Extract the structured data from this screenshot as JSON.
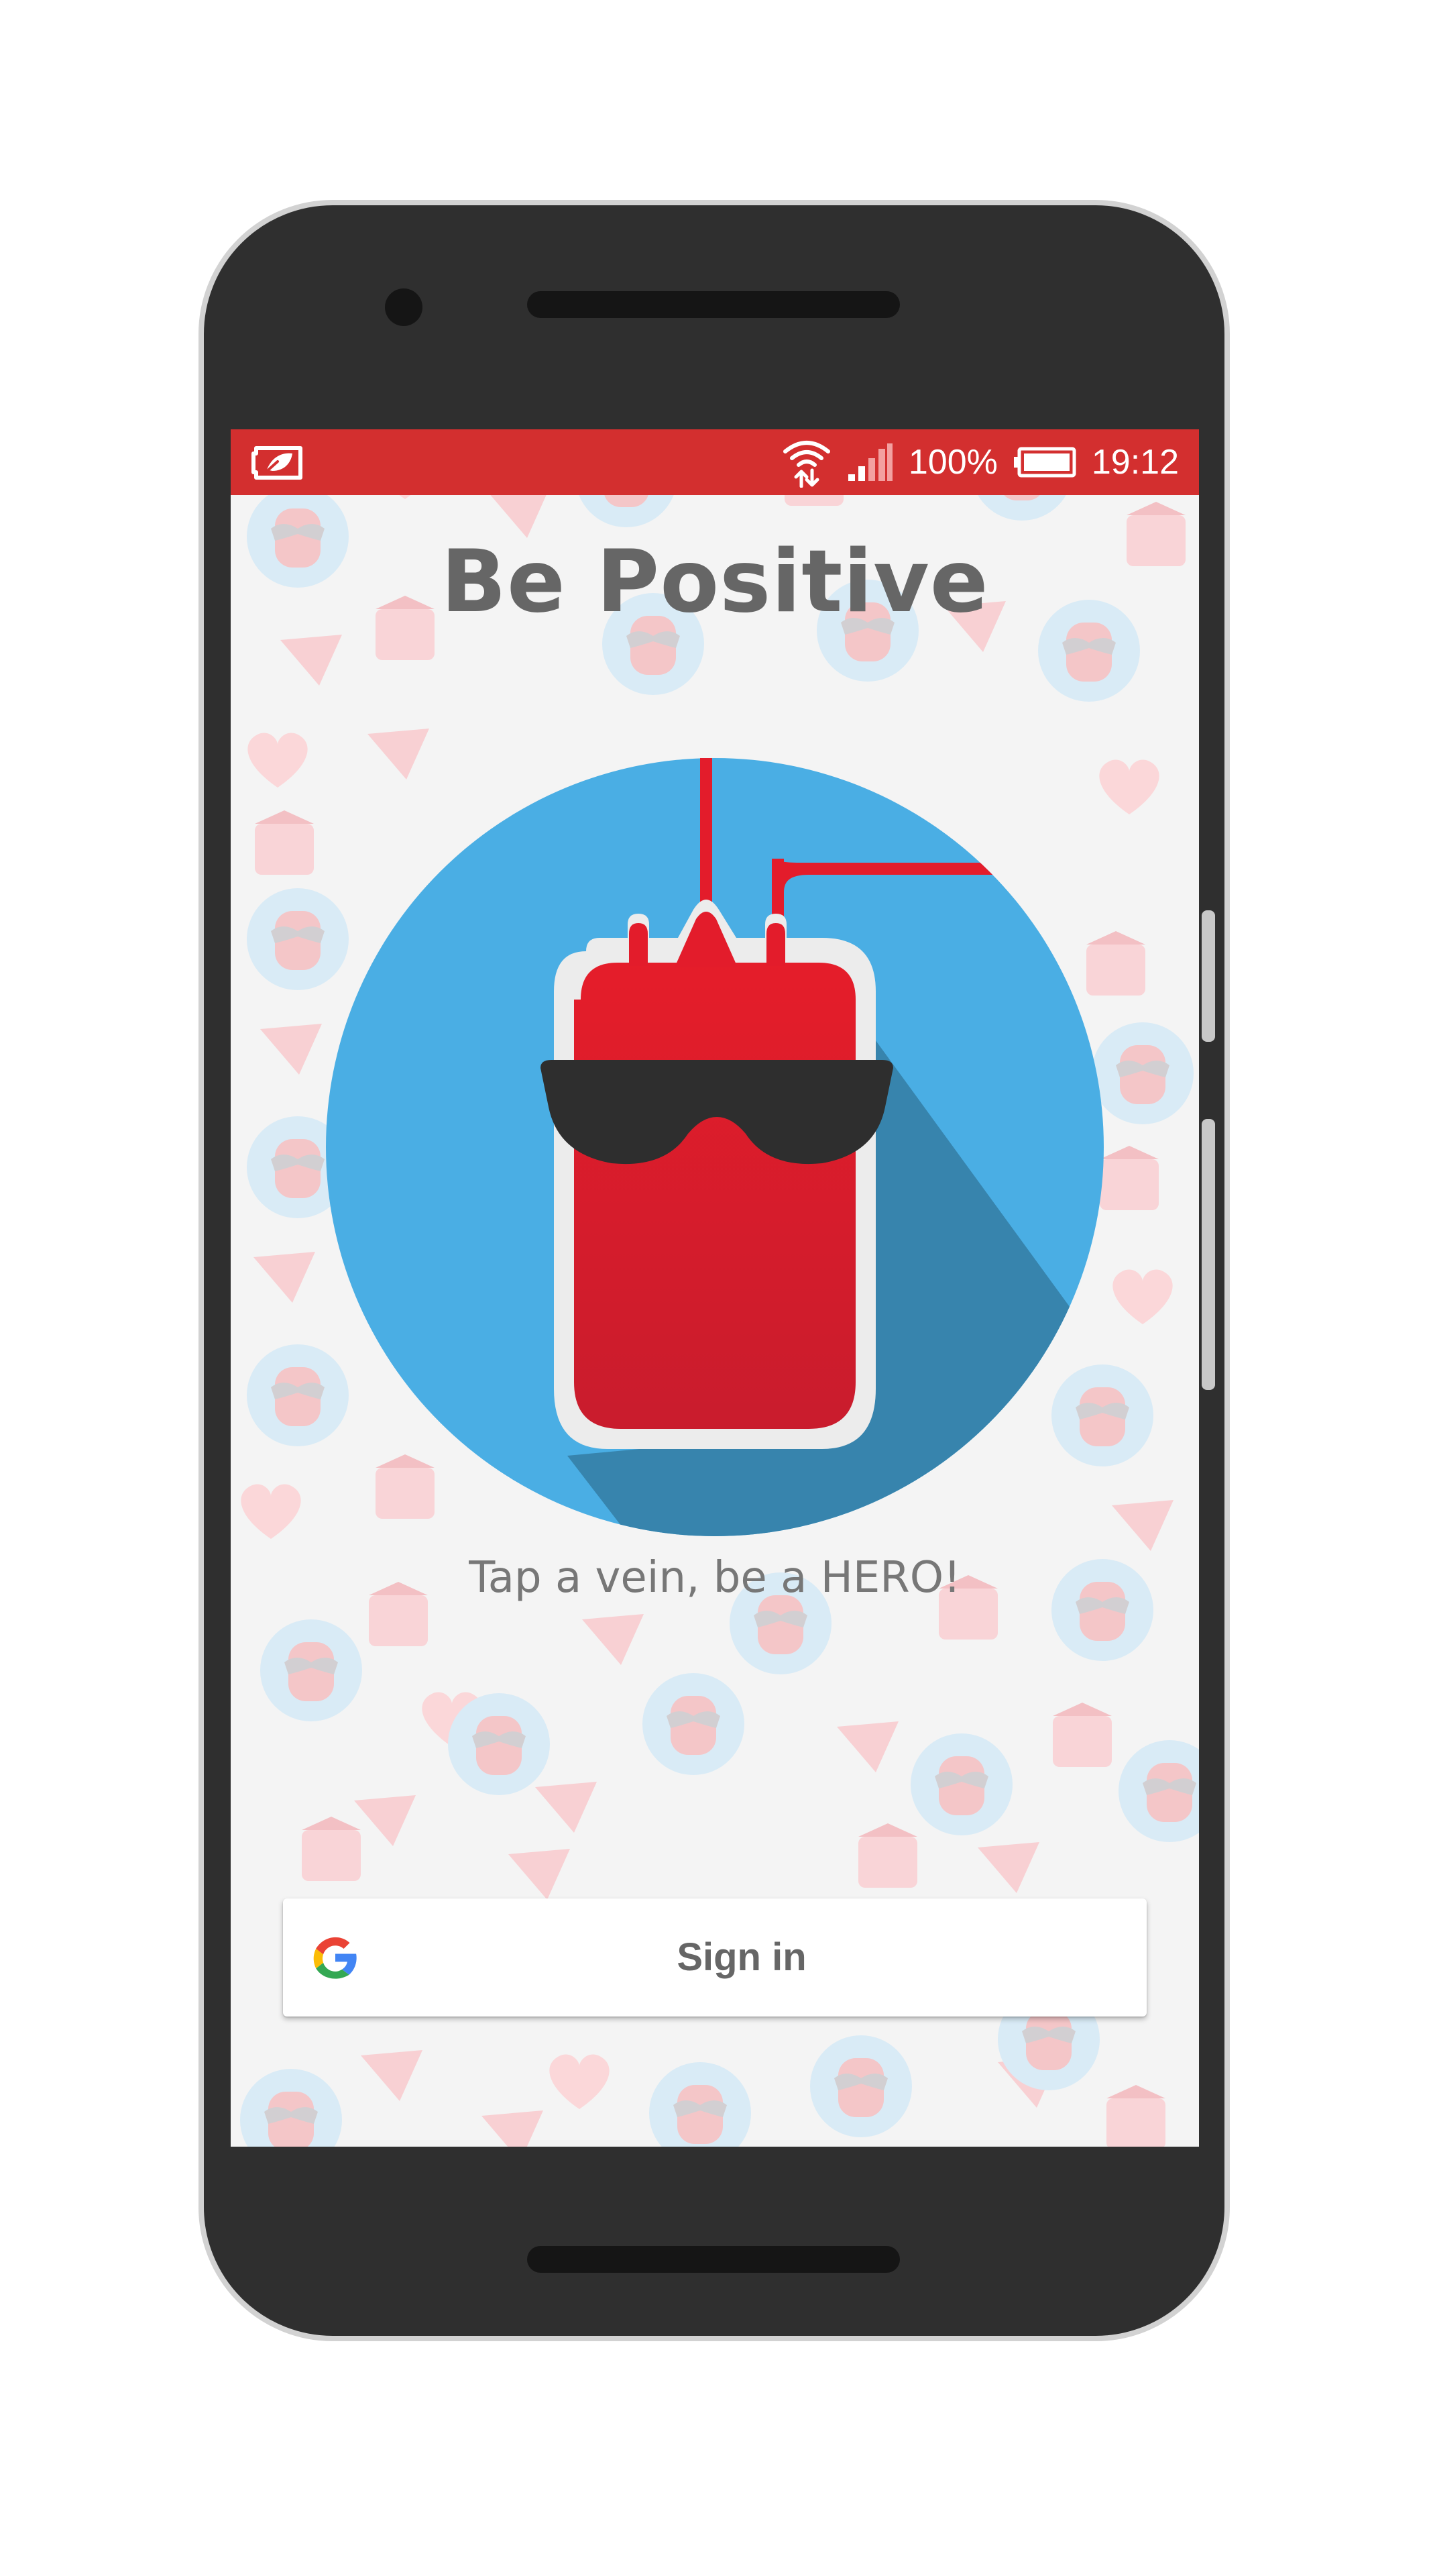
{
  "status_bar": {
    "battery_percent": "100%",
    "time": "19:12",
    "left_icon": "battery-saver-icon",
    "icons": [
      "wifi-icon",
      "signal-icon",
      "battery-icon"
    ]
  },
  "app": {
    "title": "Be Positive",
    "tagline": "Tap a vein, be a HERO!"
  },
  "signin": {
    "label": "Sign in",
    "icon": "google-logo-icon"
  },
  "colors": {
    "status_bar": "#d32f2f",
    "circle": "#4aaee4",
    "blood_bag": "#e31c2b",
    "title_text": "#666666",
    "screen_background": "#f4f4f4"
  }
}
